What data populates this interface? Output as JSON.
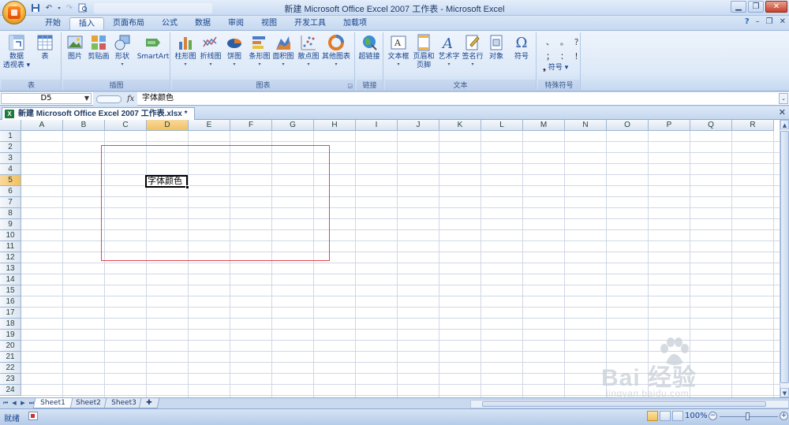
{
  "window": {
    "title": "新建 Microsoft Office Excel 2007 工作表 - Microsoft Excel",
    "controls": [
      "minimize-icon",
      "restore-icon",
      "close-icon"
    ]
  },
  "quick_access": [
    "save-icon",
    "undo-icon",
    "redo-icon",
    "print-preview-icon"
  ],
  "ribbon": {
    "tabs": [
      {
        "label": "开始",
        "active": false
      },
      {
        "label": "插入",
        "active": true
      },
      {
        "label": "页面布局",
        "active": false
      },
      {
        "label": "公式",
        "active": false
      },
      {
        "label": "数据",
        "active": false
      },
      {
        "label": "审阅",
        "active": false
      },
      {
        "label": "视图",
        "active": false
      },
      {
        "label": "开发工具",
        "active": false
      },
      {
        "label": "加载项",
        "active": false
      }
    ],
    "groups": {
      "table": {
        "label": "表",
        "pivot": {
          "line1": "数据",
          "line2": "透视表 ▾"
        },
        "table": "表"
      },
      "illustrations": {
        "label": "插图",
        "picture": "图片",
        "clipart": "剪贴画",
        "shapes": "形状",
        "smartart": "SmartArt"
      },
      "charts": {
        "label": "图表",
        "column": "柱形图",
        "line": "折线图",
        "pie": "饼图",
        "bar": "条形图",
        "area": "面积图",
        "scatter": "散点图",
        "other": "其他图表"
      },
      "links": {
        "label": "链接",
        "hyperlink": "超链接"
      },
      "text": {
        "label": "文本",
        "textbox": "文本框",
        "header_footer": {
          "line1": "页眉和",
          "line2": "页脚"
        },
        "wordart": "艺术字",
        "signature": "签名行",
        "object": "对象",
        "symbol": "符号"
      },
      "special": {
        "label": "特殊符号",
        "chars": [
          "、",
          "。",
          "？",
          "；",
          "：",
          "！"
        ],
        "symbol_btn": "符号 ▾"
      }
    }
  },
  "formula_bar": {
    "name_box": "D5",
    "fx": "fx",
    "content": "字体颜色"
  },
  "workbook_tab": {
    "title": "新建 Microsoft Office Excel 2007 工作表.xlsx *"
  },
  "grid": {
    "columns": [
      "A",
      "B",
      "C",
      "D",
      "E",
      "F",
      "G",
      "H",
      "I",
      "J",
      "K",
      "L",
      "M",
      "N",
      "O",
      "P",
      "Q",
      "R"
    ],
    "rows": [
      "1",
      "2",
      "3",
      "4",
      "5",
      "6",
      "7",
      "8",
      "9",
      "10",
      "11",
      "12",
      "13",
      "14",
      "15",
      "16",
      "17",
      "18",
      "19",
      "20",
      "21",
      "22",
      "23",
      "24"
    ],
    "selected_column": "D",
    "selected_row": "5",
    "active_cell_text": "字体颜色"
  },
  "sheets": [
    {
      "label": "Sheet1",
      "active": true
    },
    {
      "label": "Sheet2",
      "active": false
    },
    {
      "label": "Sheet3",
      "active": false
    }
  ],
  "status": {
    "ready": "就绪",
    "zoom": "100%"
  },
  "watermark": {
    "main": "Bai 经验",
    "sub": "jingyan.baidu.com"
  },
  "colors": {
    "ribbon_text": "#15428b",
    "selection_header": "#f1c15f",
    "annotation_box": "#e0474c"
  }
}
